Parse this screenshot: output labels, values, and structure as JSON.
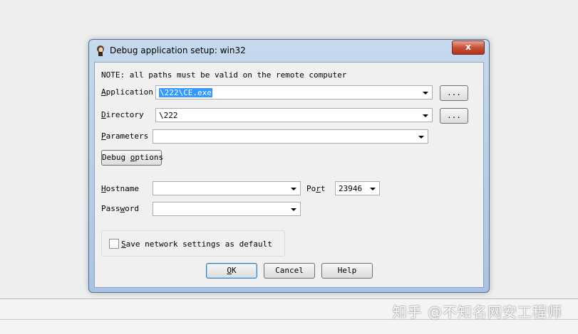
{
  "dialog": {
    "title": "Debug application setup: win32",
    "close_glyph": "x",
    "note": "NOTE: all paths must be valid on the remote computer",
    "application": {
      "label_accel": "A",
      "label_rest": "pplication",
      "value": "\\222\\CE.exe"
    },
    "directory": {
      "label_accel": "D",
      "label_rest": "irectory",
      "value": "\\222"
    },
    "parameters": {
      "label_accel": "P",
      "label_rest": "arameters",
      "value": ""
    },
    "browse_label": "...",
    "debug_options": {
      "pre": "Debug ",
      "accel": "o",
      "post": "ptions"
    },
    "hostname": {
      "label_accel": "H",
      "label_rest": "ostname",
      "value": ""
    },
    "port": {
      "label_pre": "Po",
      "label_accel": "r",
      "label_post": "t",
      "value": "23946"
    },
    "password": {
      "label_pre": "Pass",
      "label_accel": "w",
      "label_post": "ord",
      "value": ""
    },
    "save_network": {
      "accel": "S",
      "rest": "ave network settings as default",
      "checked": false
    },
    "ok": {
      "accel": "O",
      "rest": "K"
    },
    "cancel_label": "Cancel",
    "help_label": "Help"
  },
  "watermark": "知乎 @不知名网安工程师",
  "colors": {
    "selection": "#3399ff",
    "close": "#c75037",
    "frame": "#a9c4e2"
  }
}
